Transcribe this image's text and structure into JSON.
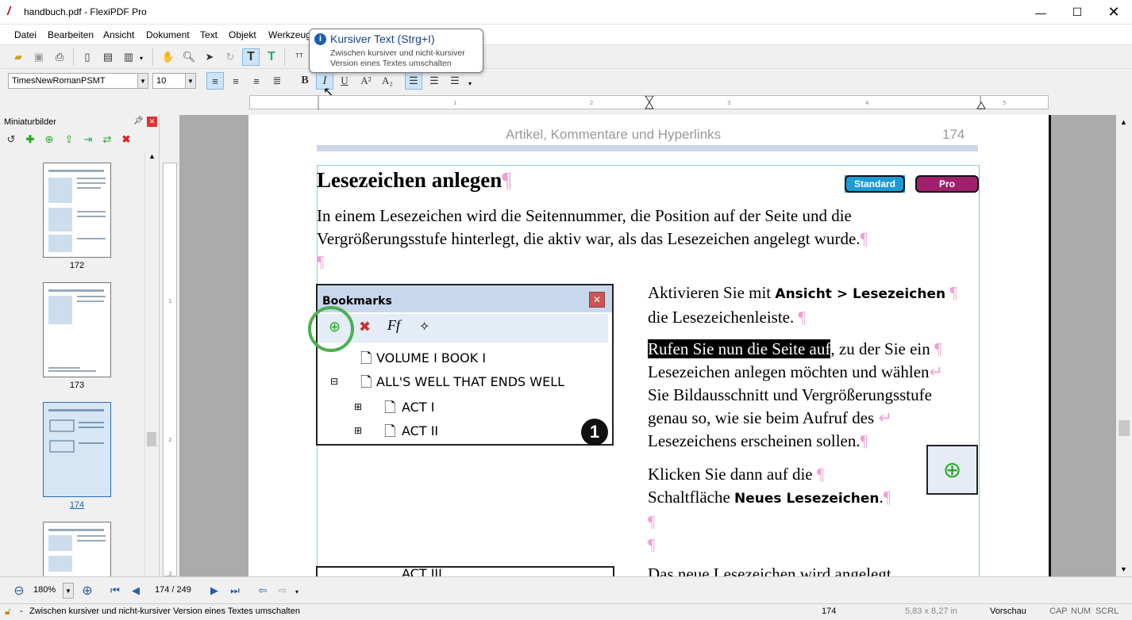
{
  "window": {
    "title": "handbuch.pdf - FlexiPDF Pro"
  },
  "menu": [
    "Datei",
    "Bearbeiten",
    "Ansicht",
    "Dokument",
    "Text",
    "Objekt",
    "Werkzeug"
  ],
  "format": {
    "font": "TimesNewRomanPSMT",
    "size": "10"
  },
  "tooltip": {
    "title": "Kursiver Text (Strg+I)",
    "body": "Zwischen kursiver und nicht-kursiver Version eines Textes umschalten"
  },
  "thumbnails": {
    "title": "Miniaturbilder",
    "pages": [
      "172",
      "173",
      "174"
    ]
  },
  "page": {
    "header": "Artikel, Kommentare und Hyperlinks",
    "number": "174",
    "heading": "Lesezeichen anlegen",
    "badges": [
      "Standard",
      "Pro"
    ],
    "intro": "In einem Lesezeichen wird die Seitennummer, die Position auf der Seite und die Vergrößerungsstufe hinterlegt, die aktiv war, als das Lesezeichen angelegt wurde.",
    "bookmarks": {
      "title": "Bookmarks",
      "items": [
        "VOLUME I BOOK I",
        "ALL'S WELL THAT ENDS WELL",
        "ACT I",
        "ACT II"
      ],
      "step": "1",
      "lower_item": "ACT III"
    },
    "p1_a": "Aktivieren Sie mit ",
    "p1_b": "Ansicht > Lesezeichen",
    "p1_c": "die Lesezeichenleiste.",
    "p2_sel": "Rufen Sie nun die Seite auf",
    "p2_l1": ", zu der Sie ein",
    "p2_l2": "Lesezeichen anlegen möchten und wählen",
    "p2_l3": "Sie Bildausschnitt und Vergrößerungsstufe",
    "p2_l4": "genau so, wie sie beim Aufruf des",
    "p2_l5": "Lesezeichens erscheinen sollen.",
    "p3_l1": "Klicken Sie dann auf die",
    "p3_l2": "Schaltfläche ",
    "p3_b": "Neues Lesezeichen",
    "p3_end": ".",
    "p4": "Das neue Lesezeichen wird angelegt"
  },
  "nav": {
    "zoom": "180%",
    "page": "174 / 249"
  },
  "status": {
    "message": "Zwischen kursiver und nicht-kursiver Version eines Textes umschalten",
    "page": "174",
    "size": "5,83 x 8,27 in",
    "mode": "Vorschau",
    "cap": "CAP",
    "num": "NUM",
    "scrl": "SCRL"
  },
  "colors": {
    "badge_standard": "#1e9ad6",
    "badge_pro": "#a0206e",
    "selection": "#000000",
    "circle": "#4caf50"
  }
}
